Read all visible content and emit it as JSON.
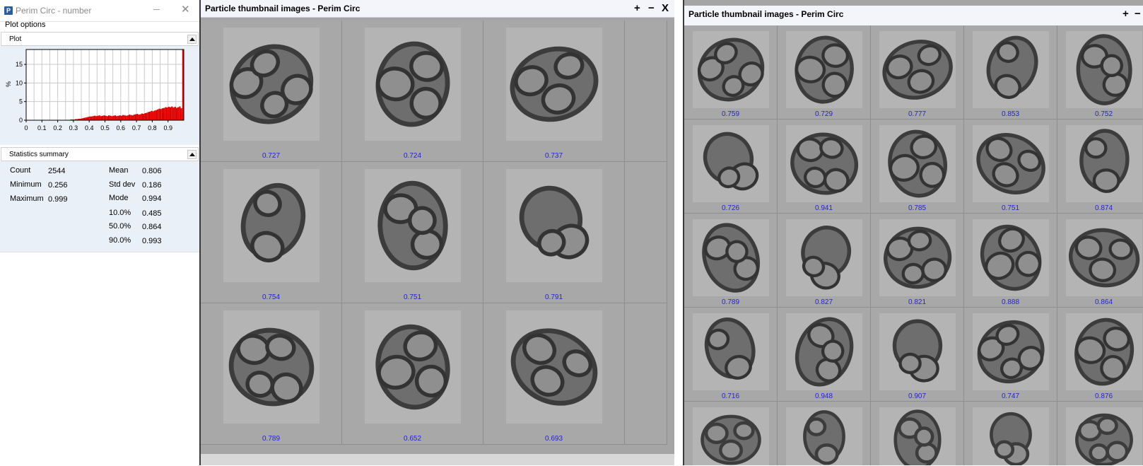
{
  "left_panel": {
    "title": "Perim Circ - number",
    "app_icon": "P",
    "plot_options_label": "Plot options",
    "plot_section_label": "Plot",
    "stats_section_label": "Statistics summary",
    "histogram": {
      "ylabel": "%",
      "ytick_labels": [
        "0",
        "5",
        "10",
        "15"
      ],
      "xtick_labels": [
        "0",
        "0.1",
        "0.2",
        "0.3",
        "0.4",
        "0.5",
        "0.6",
        "0.7",
        "0.8",
        "0.9"
      ]
    },
    "stats": {
      "count_label": "Count",
      "count_value": "2544",
      "min_label": "Minimum",
      "min_value": "0.256",
      "max_label": "Maximum",
      "max_value": "0.999",
      "mean_label": "Mean",
      "mean_value": "0.806",
      "std_label": "Std dev",
      "std_value": "0.186",
      "mode_label": "Mode",
      "mode_value": "0.994",
      "p10_label": "10.0%",
      "p10_value": "0.485",
      "p50_label": "50.0%",
      "p50_value": "0.864",
      "p90_label": "90.0%",
      "p90_value": "0.993"
    },
    "colors": {
      "panel_bg": "#eaf0f7",
      "bars": "#e00000",
      "title_text": "#8a8a8a"
    }
  },
  "chart_data": {
    "type": "bar",
    "title": "",
    "xlabel": "",
    "ylabel": "%",
    "xlim": [
      0,
      1
    ],
    "ylim": [
      0,
      19
    ],
    "grid": true,
    "bin_width": 0.01,
    "bin_starts": [
      0.25,
      0.26,
      0.27,
      0.28,
      0.29,
      0.3,
      0.31,
      0.32,
      0.33,
      0.34,
      0.35,
      0.36,
      0.37,
      0.38,
      0.39,
      0.4,
      0.41,
      0.42,
      0.43,
      0.44,
      0.45,
      0.46,
      0.47,
      0.48,
      0.49,
      0.5,
      0.51,
      0.52,
      0.53,
      0.54,
      0.55,
      0.56,
      0.57,
      0.58,
      0.59,
      0.6,
      0.61,
      0.62,
      0.63,
      0.64,
      0.65,
      0.66,
      0.67,
      0.68,
      0.69,
      0.7,
      0.71,
      0.72,
      0.73,
      0.74,
      0.75,
      0.76,
      0.77,
      0.78,
      0.79,
      0.8,
      0.81,
      0.82,
      0.83,
      0.84,
      0.85,
      0.86,
      0.87,
      0.88,
      0.89,
      0.9,
      0.91,
      0.92,
      0.93,
      0.94,
      0.95,
      0.96,
      0.97,
      0.98,
      0.99
    ],
    "values": [
      0.1,
      0.1,
      0.1,
      0.2,
      0.2,
      0.2,
      0.3,
      0.3,
      0.4,
      0.4,
      0.5,
      0.6,
      0.7,
      0.8,
      0.9,
      1.0,
      1.0,
      1.1,
      1.2,
      1.1,
      1.2,
      1.3,
      1.1,
      1.2,
      1.3,
      1.2,
      1.1,
      1.3,
      1.2,
      1.1,
      1.2,
      1.3,
      1.1,
      1.2,
      1.3,
      1.2,
      1.4,
      1.3,
      1.2,
      1.3,
      1.5,
      1.4,
      1.3,
      1.5,
      1.6,
      1.7,
      1.5,
      1.6,
      1.8,
      1.7,
      1.9,
      2.0,
      2.2,
      2.3,
      2.5,
      2.4,
      2.6,
      2.7,
      2.9,
      3.1,
      3.0,
      3.2,
      3.3,
      3.5,
      3.4,
      3.6,
      3.5,
      3.7,
      3.4,
      3.6,
      3.3,
      3.5,
      3.7,
      3.2,
      19.0
    ]
  },
  "window1": {
    "title": "Particle thumbnail images - Perim Circ",
    "plus_label": "+",
    "minus_label": "−",
    "close_label": "X",
    "values": [
      "0.727",
      "0.724",
      "0.737",
      "0.754",
      "0.751",
      "0.791",
      "0.789",
      "0.652",
      "0.693"
    ]
  },
  "window2": {
    "title": "Particle thumbnail images - Perim Circ",
    "plus_label": "+",
    "minus_label": "−",
    "values": [
      "0.759",
      "0.729",
      "0.777",
      "0.853",
      "0.752",
      "0.726",
      "0.941",
      "0.785",
      "0.751",
      "0.874",
      "0.789",
      "0.827",
      "0.821",
      "0.888",
      "0.864",
      "0.716",
      "0.948",
      "0.907",
      "0.747",
      "0.876"
    ]
  },
  "colors": {
    "value_text": "#1f1fe0",
    "cell_bg": "#a8a8a8",
    "thumb_bg": "#b4b4b4",
    "particle": "#3c3c3c",
    "title_bar": "#f4f4fb"
  }
}
